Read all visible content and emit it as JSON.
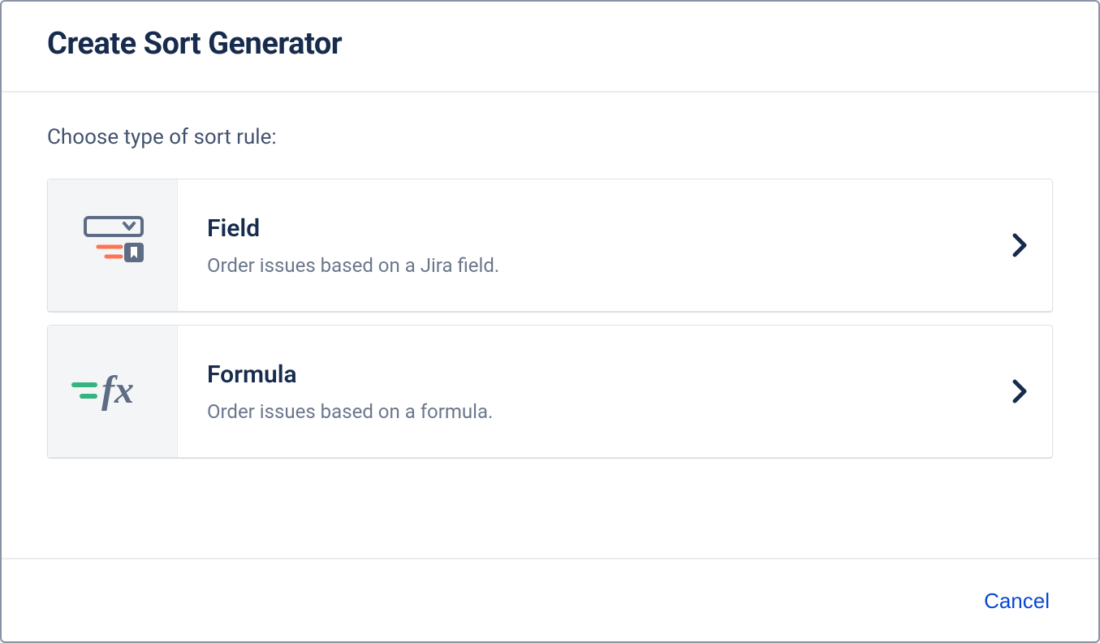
{
  "dialog": {
    "title": "Create Sort Generator",
    "instruction": "Choose type of sort rule:",
    "options": [
      {
        "title": "Field",
        "description": "Order issues based on a Jira field."
      },
      {
        "title": "Formula",
        "description": "Order issues based on a formula."
      }
    ],
    "cancel_label": "Cancel"
  }
}
